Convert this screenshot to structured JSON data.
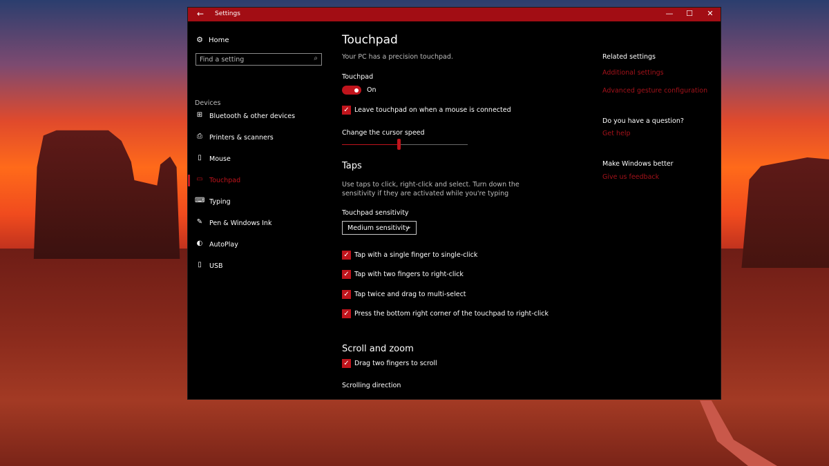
{
  "window": {
    "title": "Settings",
    "back_icon": "arrow-left-icon",
    "controls": {
      "minimize": "—",
      "maximize": "☐",
      "close": "✕"
    }
  },
  "sidebar": {
    "home_label": "Home",
    "search_placeholder": "Find a setting",
    "section_label": "Devices",
    "items": [
      {
        "label": "Bluetooth & other devices",
        "icon": "bluetooth-icon",
        "glyph": "⊞"
      },
      {
        "label": "Printers & scanners",
        "icon": "printer-icon",
        "glyph": "⎙"
      },
      {
        "label": "Mouse",
        "icon": "mouse-icon",
        "glyph": "▯"
      },
      {
        "label": "Touchpad",
        "icon": "touchpad-icon",
        "glyph": "▭",
        "active": true
      },
      {
        "label": "Typing",
        "icon": "keyboard-icon",
        "glyph": "⌨"
      },
      {
        "label": "Pen & Windows Ink",
        "icon": "pen-icon",
        "glyph": "✎"
      },
      {
        "label": "AutoPlay",
        "icon": "autoplay-icon",
        "glyph": "◐"
      },
      {
        "label": "USB",
        "icon": "usb-icon",
        "glyph": "▯"
      }
    ]
  },
  "main": {
    "title": "Touchpad",
    "subtitle": "Your PC has a precision touchpad.",
    "touchpad_label": "Touchpad",
    "toggle_state": "On",
    "leave_on_label": "Leave touchpad on when a mouse is connected",
    "cursor_speed_label": "Change the cursor speed",
    "cursor_speed_fraction": 0.45,
    "taps_heading": "Taps",
    "taps_description": "Use taps to click, right-click and select. Turn down the sensitivity if they are activated while you're typing",
    "sensitivity_label": "Touchpad sensitivity",
    "sensitivity_value": "Medium sensitivity",
    "tap_options": [
      "Tap with a single finger to single-click",
      "Tap with two fingers to right-click",
      "Tap twice and drag to multi-select",
      "Press the bottom right corner of the touchpad to right-click"
    ],
    "scroll_heading": "Scroll and zoom",
    "scroll_option": "Drag two fingers to scroll",
    "scroll_direction_label": "Scrolling direction"
  },
  "related": {
    "heading": "Related settings",
    "links": [
      "Additional settings",
      "Advanced gesture configuration"
    ],
    "question_heading": "Do you have a question?",
    "help_link": "Get help",
    "better_heading": "Make Windows better",
    "feedback_link": "Give us feedback"
  },
  "colors": {
    "accent": "#c0141c",
    "titlebar": "#a20d14",
    "link": "#a3121a"
  }
}
